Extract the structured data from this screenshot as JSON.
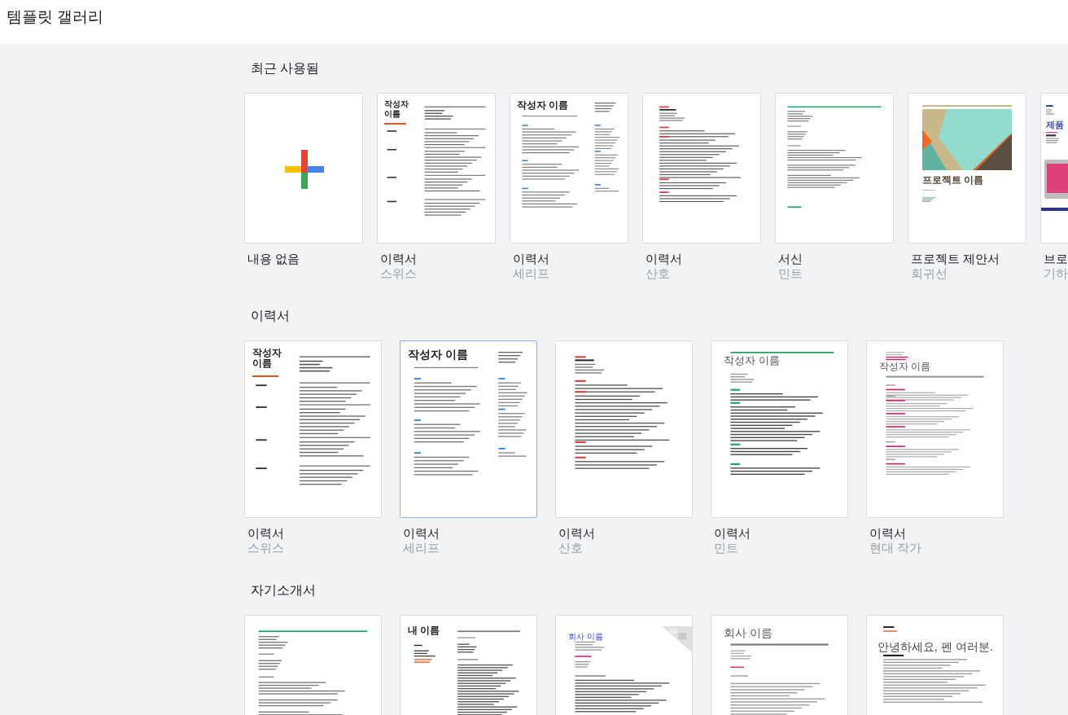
{
  "header": {
    "title": "템플릿 갤러리"
  },
  "sections": [
    {
      "title": "최근 사용됨",
      "kind": "recent",
      "templates": [
        {
          "title": "내용 없음",
          "selected": false,
          "preview": {
            "kind": "blank"
          }
        },
        {
          "title": "이력서",
          "subtitle": "스위스",
          "selected": false,
          "preview": {
            "kind": "swiss",
            "heading": "작성자 이름"
          }
        },
        {
          "title": "이력서",
          "subtitle": "세리프",
          "selected": false,
          "preview": {
            "kind": "serif",
            "heading": "작성자 이름"
          }
        },
        {
          "title": "이력서",
          "subtitle": "산호",
          "selected": false,
          "preview": {
            "kind": "coral"
          }
        },
        {
          "title": "서신",
          "subtitle": "민트",
          "selected": false,
          "preview": {
            "kind": "letter-mint"
          }
        },
        {
          "title": "프로젝트 제안서",
          "subtitle": "회귀선",
          "selected": false,
          "preview": {
            "kind": "proposal",
            "heading": "프로젝트 이름"
          }
        },
        {
          "title": "브로",
          "subtitle": "기하",
          "selected": false,
          "preview": {
            "kind": "brochure",
            "heading": "제품"
          }
        }
      ]
    },
    {
      "title": "이력서",
      "kind": "category",
      "templates": [
        {
          "title": "이력서",
          "subtitle": "스위스",
          "selected": false,
          "preview": {
            "kind": "swiss",
            "heading": "작성자 이름"
          }
        },
        {
          "title": "이력서",
          "subtitle": "세리프",
          "selected": true,
          "preview": {
            "kind": "serif",
            "heading": "작성자 이름"
          }
        },
        {
          "title": "이력서",
          "subtitle": "산호",
          "selected": false,
          "preview": {
            "kind": "coral"
          }
        },
        {
          "title": "이력서",
          "subtitle": "민트",
          "selected": false,
          "preview": {
            "kind": "mint",
            "heading": "작성자 이름"
          }
        },
        {
          "title": "이력서",
          "subtitle": "현대 작가",
          "selected": false,
          "preview": {
            "kind": "modern",
            "heading": "작성자 이름"
          }
        }
      ]
    },
    {
      "title": "자기소개서",
      "kind": "category",
      "templates": [
        {
          "selected": false,
          "preview": {
            "kind": "letter-mint"
          }
        },
        {
          "selected": false,
          "preview": {
            "kind": "letter-swiss",
            "heading": "내 이름"
          }
        },
        {
          "selected": false,
          "preview": {
            "kind": "letter-coral",
            "heading": "회사 이름"
          }
        },
        {
          "selected": false,
          "preview": {
            "kind": "letter-spearmint",
            "heading": "회사 이름"
          }
        },
        {
          "selected": false,
          "preview": {
            "kind": "letter-modern",
            "heading": "안녕하세요, 펜 여러분."
          }
        }
      ]
    }
  ]
}
